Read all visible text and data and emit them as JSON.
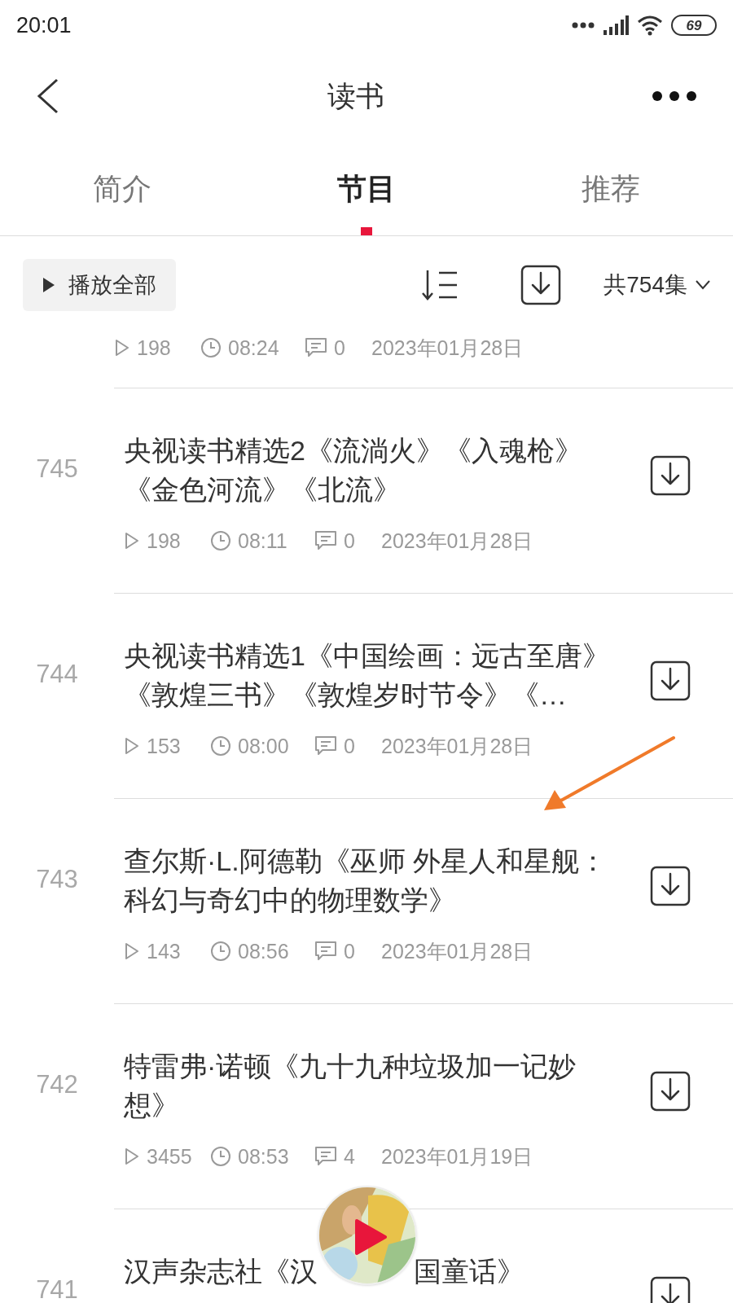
{
  "status_bar": {
    "time": "20:01",
    "battery": "69"
  },
  "header": {
    "title": "读书"
  },
  "tabs": [
    {
      "label": "简介",
      "selected": false
    },
    {
      "label": "节目",
      "selected": true
    },
    {
      "label": "推荐",
      "selected": false
    }
  ],
  "toolbar": {
    "play_all": "播放全部",
    "count": "共754集"
  },
  "episodes": [
    {
      "kind": "meta_only",
      "plays": "198",
      "duration": "08:24",
      "comments": "0",
      "date": "2023年01月28日"
    },
    {
      "index": "745",
      "title_parts": [
        "央视读书精选2《流淌火》《入魂枪》《金色河流》《北流》"
      ],
      "plays": "198",
      "duration": "08:11",
      "comments": "0",
      "date": "2023年01月28日"
    },
    {
      "index": "744",
      "title_parts": [
        "央视读书精选1《中国绘画：远古至唐》《敦煌三书》《敦煌岁时节令》《…"
      ],
      "plays": "153",
      "duration": "08:00",
      "comments": "0",
      "date": "2023年01月28日"
    },
    {
      "index": "743",
      "title_parts": [
        "查尔斯·L.阿德勒《巫师 外星人和星舰：科幻与奇幻中的物理数学》"
      ],
      "plays": "143",
      "duration": "08:56",
      "comments": "0",
      "date": "2023年01月28日"
    },
    {
      "index": "742",
      "title_parts": [
        "特雷弗·诺顿《九十九种垃圾加一记妙想》"
      ],
      "plays": "3455",
      "duration": "08:53",
      "comments": "4",
      "date": "2023年01月19日"
    },
    {
      "index": "741",
      "title_parts": [
        "汉声杂志社《汉",
        "国童话》"
      ]
    }
  ]
}
